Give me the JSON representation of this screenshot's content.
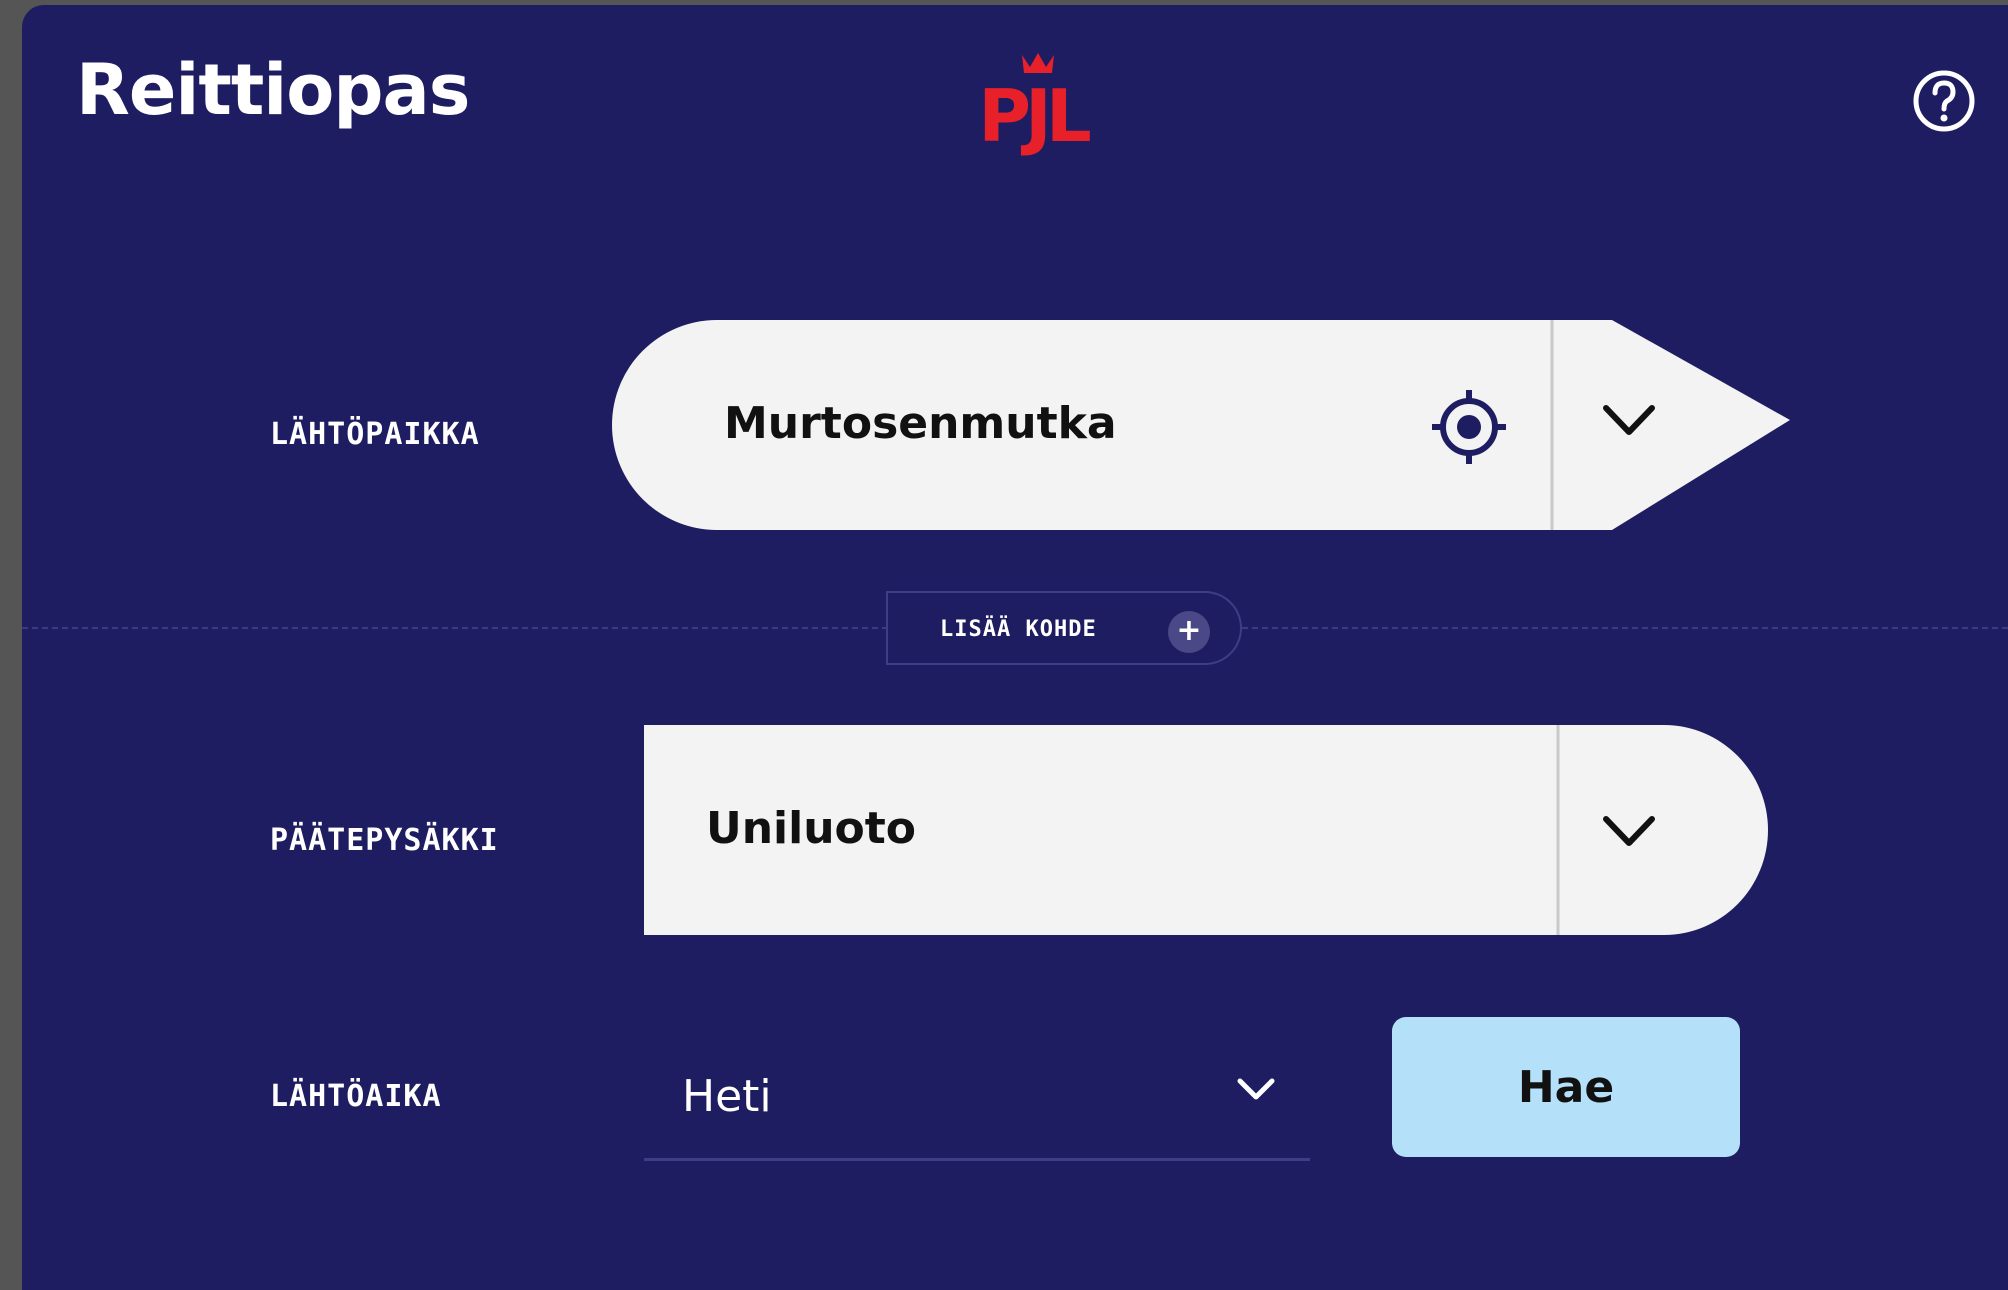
{
  "header": {
    "title": "Reittiopas",
    "logo_text": "PJL",
    "help_icon": "question-circle-icon"
  },
  "form": {
    "origin": {
      "label": "LÄHTÖPAIKKA",
      "value": "Murtosenmutka",
      "locate_icon": "crosshair-icon",
      "toggle_icon": "chevron-down-icon"
    },
    "add_destination": {
      "label": "LISÄÄ KOHDE",
      "icon": "plus-icon"
    },
    "destination": {
      "label": "PÄÄTEPYSÄKKI",
      "value": "Uniluoto",
      "toggle_icon": "chevron-down-icon"
    },
    "departure_time": {
      "label": "LÄHTÖAIKA",
      "value": "Heti",
      "toggle_icon": "chevron-down-icon"
    },
    "search_label": "Hae"
  },
  "colors": {
    "background": "#1f1d61",
    "field": "#f3f3f3",
    "logo": "#e8202a",
    "search_button": "#b4e1f9",
    "text_light": "#ffffff",
    "text_dark": "#111111"
  }
}
